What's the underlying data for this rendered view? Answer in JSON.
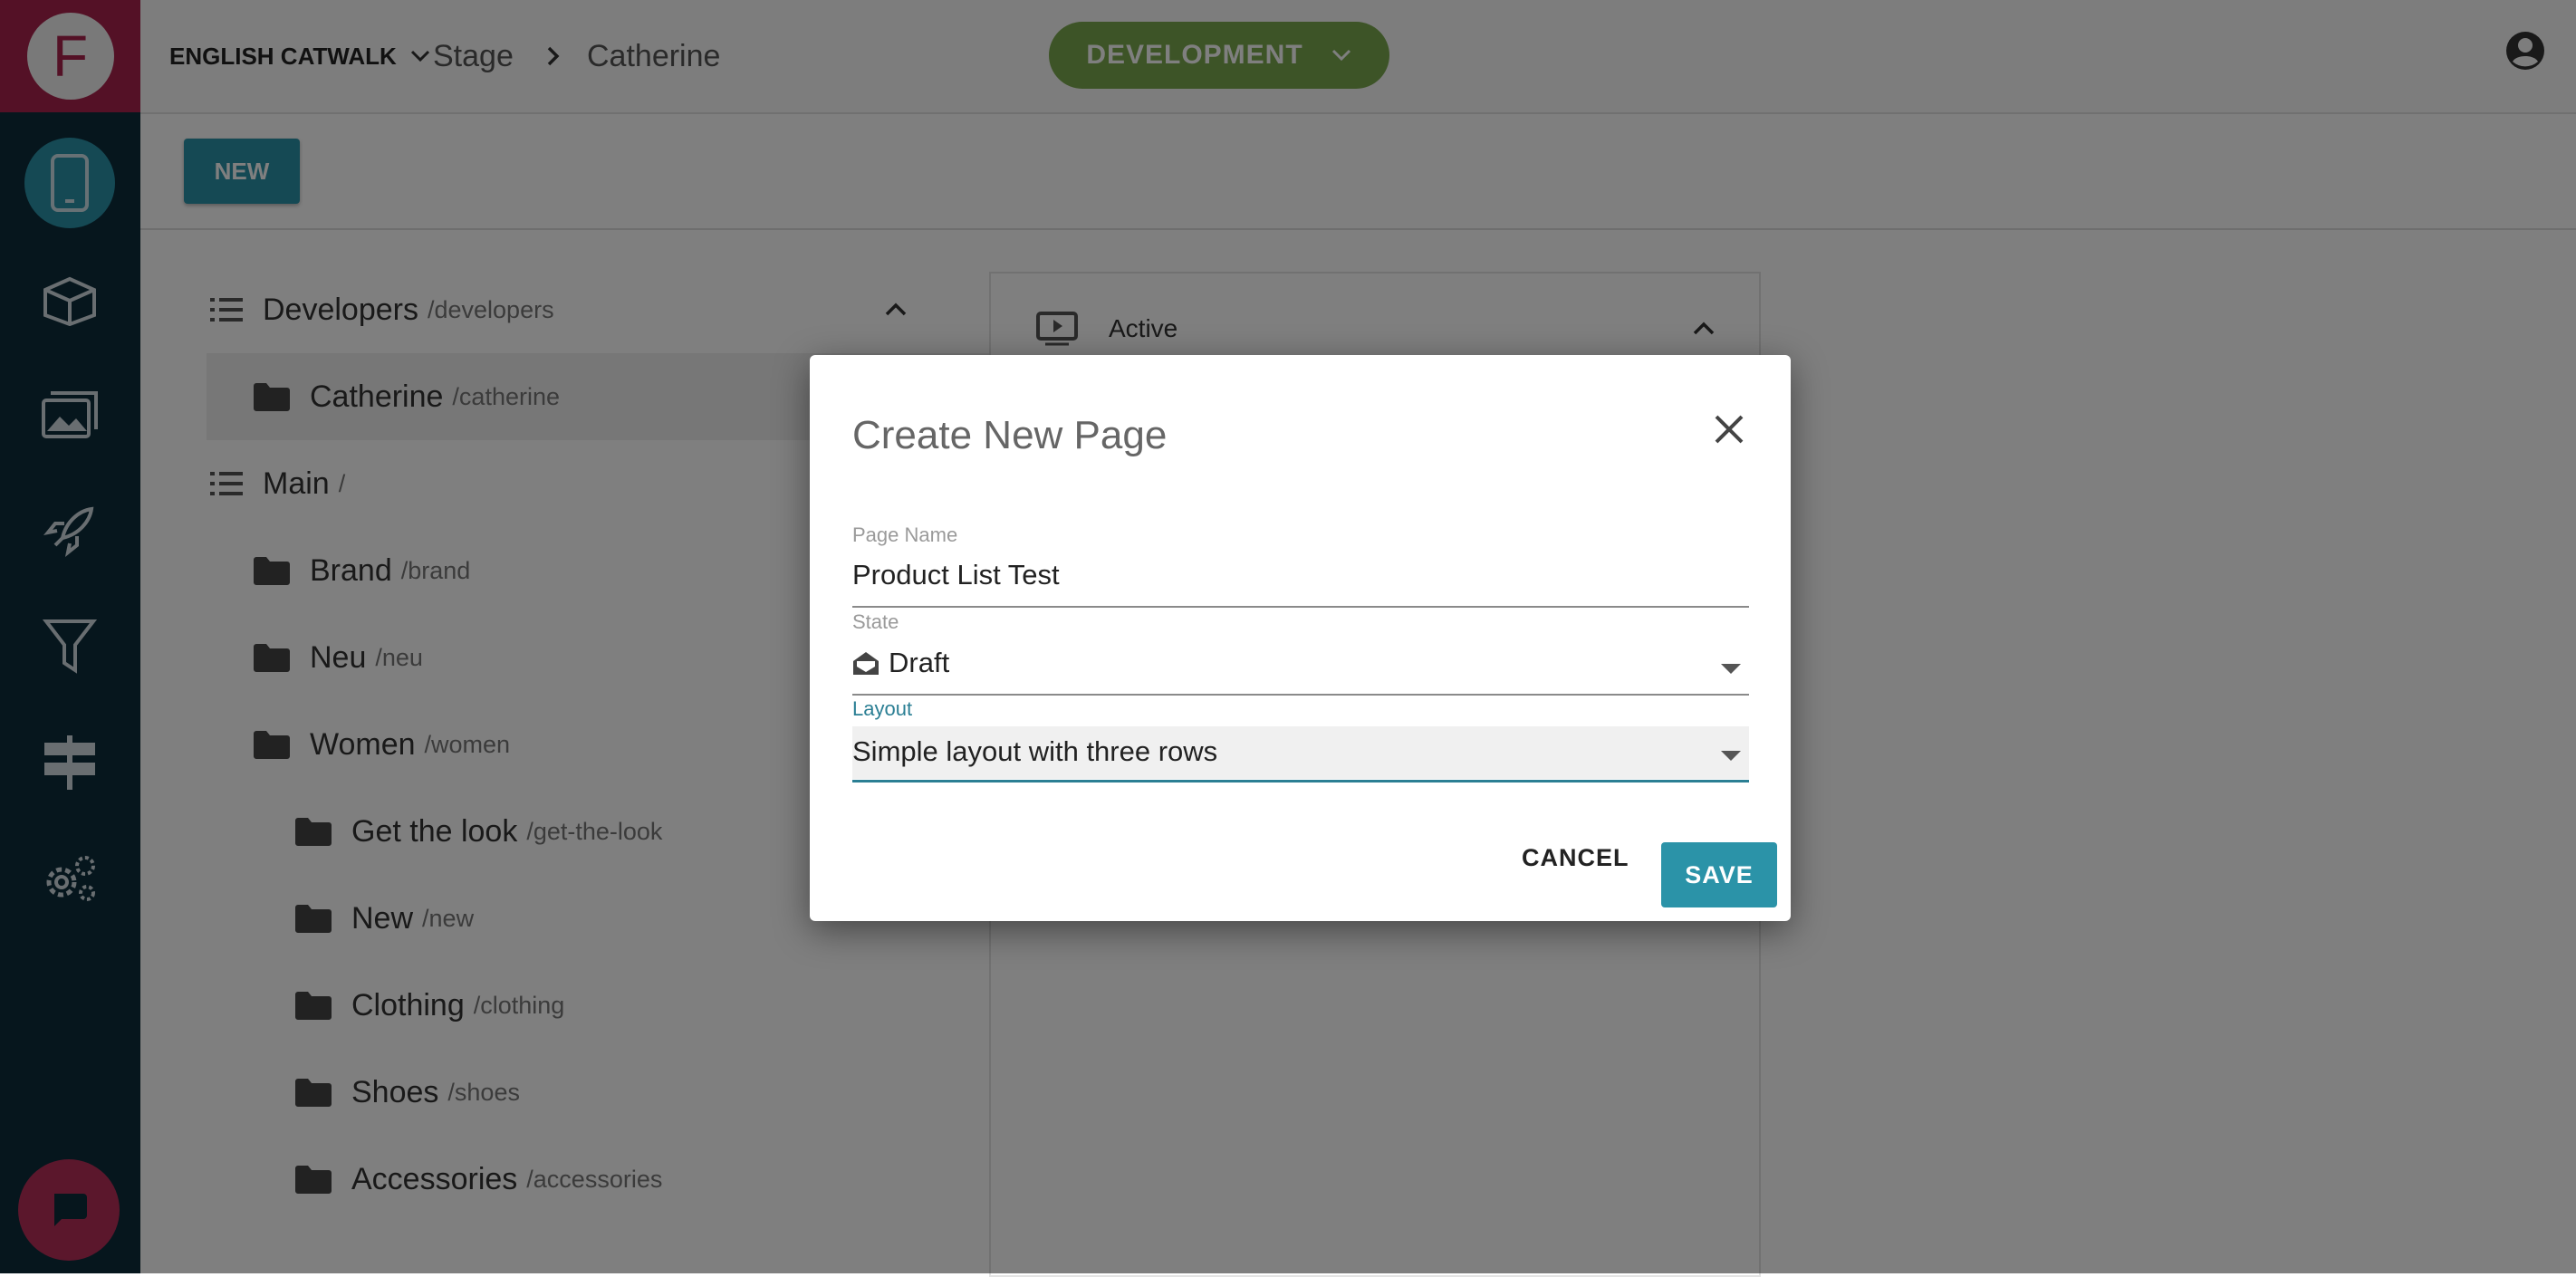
{
  "app": {
    "logo_letter": "F"
  },
  "header": {
    "workspace": "ENGLISH CATWALK",
    "breadcrumb": [
      "Stage",
      "Catherine"
    ],
    "environment": "DEVELOPMENT"
  },
  "sidebar": {
    "items": [
      {
        "icon": "mobile-icon",
        "active": true
      },
      {
        "icon": "package-icon"
      },
      {
        "icon": "images-icon"
      },
      {
        "icon": "rocket-icon"
      },
      {
        "icon": "filter-icon"
      },
      {
        "icon": "signpost-icon"
      },
      {
        "icon": "gears-icon"
      }
    ],
    "chat_icon": "chat-icon"
  },
  "toolbar": {
    "new_label": "NEW"
  },
  "tree": {
    "groups": [
      {
        "name": "Developers",
        "path": "/developers",
        "children": [
          {
            "name": "Catherine",
            "path": "/catherine",
            "selected": true
          }
        ]
      },
      {
        "name": "Main",
        "path": "/",
        "children": [
          {
            "name": "Brand",
            "path": "/brand"
          },
          {
            "name": "Neu",
            "path": "/neu"
          },
          {
            "name": "Women",
            "path": "/women",
            "children": [
              {
                "name": "Get the look",
                "path": "/get-the-look"
              },
              {
                "name": "New",
                "path": "/new"
              },
              {
                "name": "Clothing",
                "path": "/clothing"
              },
              {
                "name": "Shoes",
                "path": "/shoes"
              },
              {
                "name": "Accessories",
                "path": "/accessories"
              }
            ]
          }
        ]
      }
    ]
  },
  "panel": {
    "header": "Active"
  },
  "dialog": {
    "title": "Create New Page",
    "page_name": {
      "label": "Page Name",
      "value": "Product List Test"
    },
    "state": {
      "label": "State",
      "value": "Draft",
      "icon": "envelope-open-icon"
    },
    "layout": {
      "label": "Layout",
      "value": "Simple layout with three rows"
    },
    "cancel_label": "CANCEL",
    "save_label": "SAVE"
  },
  "colors": {
    "sidebar_bg": "#0c2c3b",
    "logo_bg": "#a8234c",
    "accent": "#2b93a8",
    "environment": "#7aa84e"
  }
}
